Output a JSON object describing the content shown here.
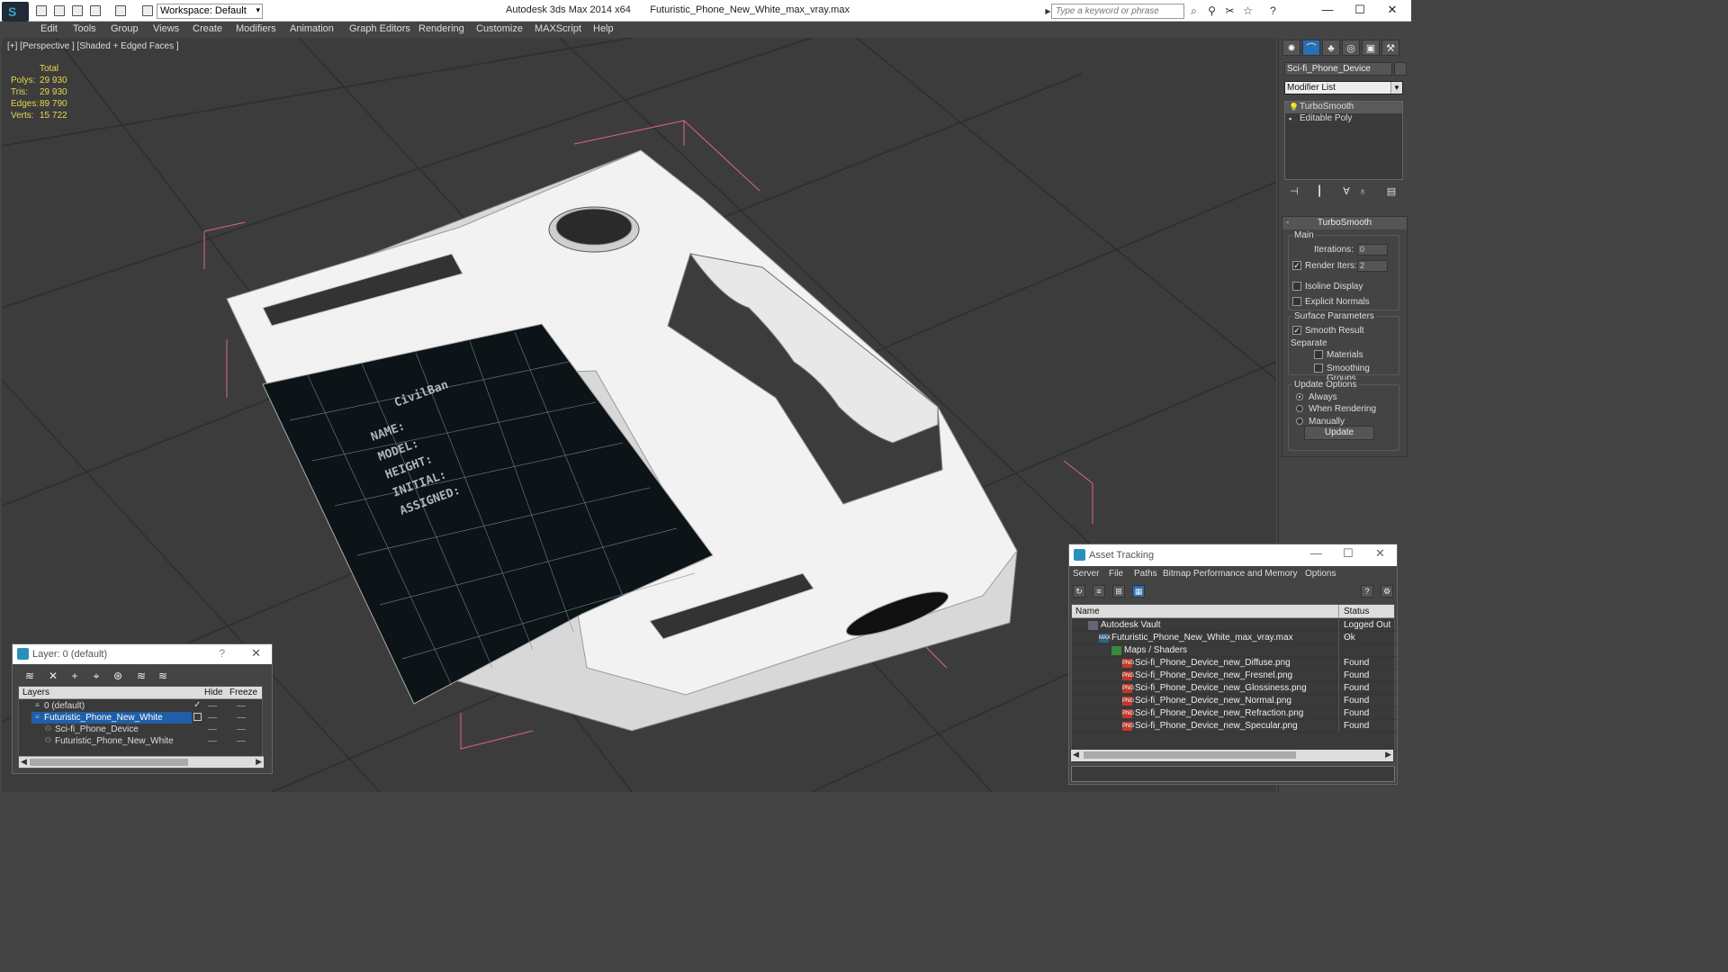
{
  "titlebar": {
    "workspace": "Workspace: Default",
    "app_name": "Autodesk 3ds Max  2014 x64",
    "file_name": "Futuristic_Phone_New_White_max_vray.max",
    "search_placeholder": "Type a keyword or phrase",
    "minimize": "—",
    "maximize": "☐",
    "close": "✕"
  },
  "menu": [
    "Edit",
    "Tools",
    "Group",
    "Views",
    "Create",
    "Modifiers",
    "Animation",
    "Graph Editors",
    "Rendering",
    "Customize",
    "MAXScript",
    "Help"
  ],
  "viewport": {
    "label": "[+] [Perspective ] [Shaded + Edged Faces ]",
    "stats": {
      "header": "Total",
      "rows": [
        {
          "label": "Polys:",
          "value": "29 930"
        },
        {
          "label": "Tris:",
          "value": "29 930"
        },
        {
          "label": "Edges:",
          "value": "89 790"
        },
        {
          "label": "Verts:",
          "value": "15 722"
        }
      ]
    },
    "screen_text": [
      "CivilBan",
      "NAME:",
      "MODEL:",
      "HEIGHT:",
      "INITIAL:",
      "ASSIGNED:"
    ]
  },
  "command_panel": {
    "object_name": "Sci-fi_Phone_Device",
    "modifier_list": "Modifier List",
    "stack": [
      "TurboSmooth",
      "Editable Poly"
    ],
    "rollout_title": "TurboSmooth",
    "main_group": "Main",
    "iterations_label": "Iterations:",
    "iterations_value": "0",
    "render_iters_label": "Render Iters:",
    "render_iters_value": "2",
    "isoline_display": "Isoline Display",
    "explicit_normals": "Explicit Normals",
    "surface_group": "Surface Parameters",
    "smooth_result": "Smooth Result",
    "separate_label": "Separate",
    "materials": "Materials",
    "smoothing_groups": "Smoothing Groups",
    "update_group": "Update Options",
    "always": "Always",
    "when_rendering": "When Rendering",
    "manually": "Manually",
    "update_button": "Update"
  },
  "layer_dialog": {
    "title": "Layer: 0 (default)",
    "help": "?",
    "close": "✕",
    "headers": {
      "layers": "Layers",
      "hide": "Hide",
      "freeze": "Freeze"
    },
    "rows": [
      {
        "name": "0 (default)",
        "icon": "≡"
      },
      {
        "name": "Futuristic_Phone_New_White",
        "icon": "≡"
      },
      {
        "name": "Sci-fi_Phone_Device",
        "icon": "⚇"
      },
      {
        "name": "Futuristic_Phone_New_White",
        "icon": "⚇"
      }
    ]
  },
  "asset_dialog": {
    "title": "Asset Tracking",
    "menu": [
      "Server",
      "File",
      "Paths",
      "Bitmap Performance and Memory",
      "Options"
    ],
    "headers": {
      "name": "Name",
      "status": "Status"
    },
    "rows": [
      {
        "name": "Autodesk Vault",
        "status": "Logged Out ...",
        "icon": "vault"
      },
      {
        "name": "Futuristic_Phone_New_White_max_vray.max",
        "status": "Ok",
        "icon": "MAX"
      },
      {
        "name": "Maps / Shaders",
        "status": "",
        "icon": "maps"
      },
      {
        "name": "Sci-fi_Phone_Device_new_Diffuse.png",
        "status": "Found",
        "icon": "PNG"
      },
      {
        "name": "Sci-fi_Phone_Device_new_Fresnel.png",
        "status": "Found",
        "icon": "PNG"
      },
      {
        "name": "Sci-fi_Phone_Device_new_Glossiness.png",
        "status": "Found",
        "icon": "PNG"
      },
      {
        "name": "Sci-fi_Phone_Device_new_Normal.png",
        "status": "Found",
        "icon": "PNG"
      },
      {
        "name": "Sci-fi_Phone_Device_new_Refraction.png",
        "status": "Found",
        "icon": "PNG"
      },
      {
        "name": "Sci-fi_Phone_Device_new_Specular.png",
        "status": "Found",
        "icon": "PNG"
      }
    ]
  },
  "colors": {
    "stats_yellow": "#e9d64e",
    "selection_blue": "#1f5fa8",
    "bbox_pink": "#d9687e"
  }
}
